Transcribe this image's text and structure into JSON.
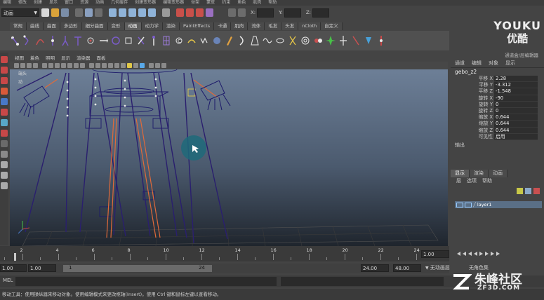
{
  "menu_bar": {
    "items": [
      "编辑",
      "修改",
      "创建",
      "显示",
      "窗口",
      "资源",
      "动画",
      "几何缓存",
      "创建变形器",
      "编辑变形器",
      "骨架",
      "蒙皮",
      "约束",
      "角色",
      "肌肉",
      "帮助"
    ]
  },
  "status_line": {
    "mode": "动画",
    "coords": {
      "x_label": "X:",
      "y_label": "Y:",
      "z_label": "Z:"
    }
  },
  "shelf": {
    "tabs": [
      "常规",
      "曲线",
      "曲面",
      "多边形",
      "细分曲面",
      "变形",
      "动画",
      "动力学",
      "渲染",
      "PaintEffects",
      "卡通",
      "肌肉",
      "流体",
      "毛发",
      "头发",
      "nCloth",
      "自定义"
    ],
    "active_tab": "动画"
  },
  "viewport": {
    "menu": [
      "视图",
      "着色",
      "照明",
      "显示",
      "渲染器",
      "面板"
    ],
    "labels": {
      "left_text_1": "端头",
      "left_text_2": "动"
    },
    "colors": {
      "joint": "#2a1f6e",
      "highlight": "#e06a3a",
      "cursor_ring": "#1e6a7a"
    }
  },
  "channel_box": {
    "title": "通道盒/层编辑器",
    "menu": [
      "通道",
      "编辑",
      "对象",
      "显示"
    ],
    "object_name": "gebo_z2",
    "attributes": [
      {
        "label": "平移 X",
        "value": "2.28"
      },
      {
        "label": "平移 Y",
        "value": "-3.312"
      },
      {
        "label": "平移 Z",
        "value": "-1.548"
      },
      {
        "label": "旋转 X",
        "value": "-90"
      },
      {
        "label": "旋转 Y",
        "value": "0"
      },
      {
        "label": "旋转 Z",
        "value": "0"
      },
      {
        "label": "缩放 X",
        "value": "0.644"
      },
      {
        "label": "缩放 Y",
        "value": "0.644"
      },
      {
        "label": "缩放 Z",
        "value": "0.644"
      },
      {
        "label": "可见性",
        "value": "启用"
      }
    ],
    "section": "输出"
  },
  "layer_editor": {
    "tabs": [
      "显示",
      "渲染",
      "动画"
    ],
    "active_tab": "显示",
    "menu": [
      "层",
      "选项",
      "帮助"
    ],
    "layer_name": "layer1"
  },
  "time_slider": {
    "ticks": [
      2,
      4,
      6,
      8,
      10,
      12,
      14,
      16,
      18,
      20,
      22,
      24
    ],
    "current_time": "1.00"
  },
  "range_slider": {
    "start_time": "1.00",
    "playback_start": "1.00",
    "range_start_label": "1",
    "range_end_label": "24",
    "playback_end": "24.00",
    "end_time": "48.00",
    "anim_layer": "无动画层",
    "char_set": "无角色集"
  },
  "command_line": {
    "label": "MEL"
  },
  "help_line": {
    "text": "移动工具：使用操纵器来移动对象。使用编辑模式来更改枢轴(Insert)。使用 Ctrl 键和鼠标左键以查看移动。"
  },
  "watermarks": {
    "youku_en": "YOUKU",
    "youku_cn": "优酷",
    "zf3d_cn": "朱峰社区",
    "zf3d_en": "ZF3D.COM"
  }
}
